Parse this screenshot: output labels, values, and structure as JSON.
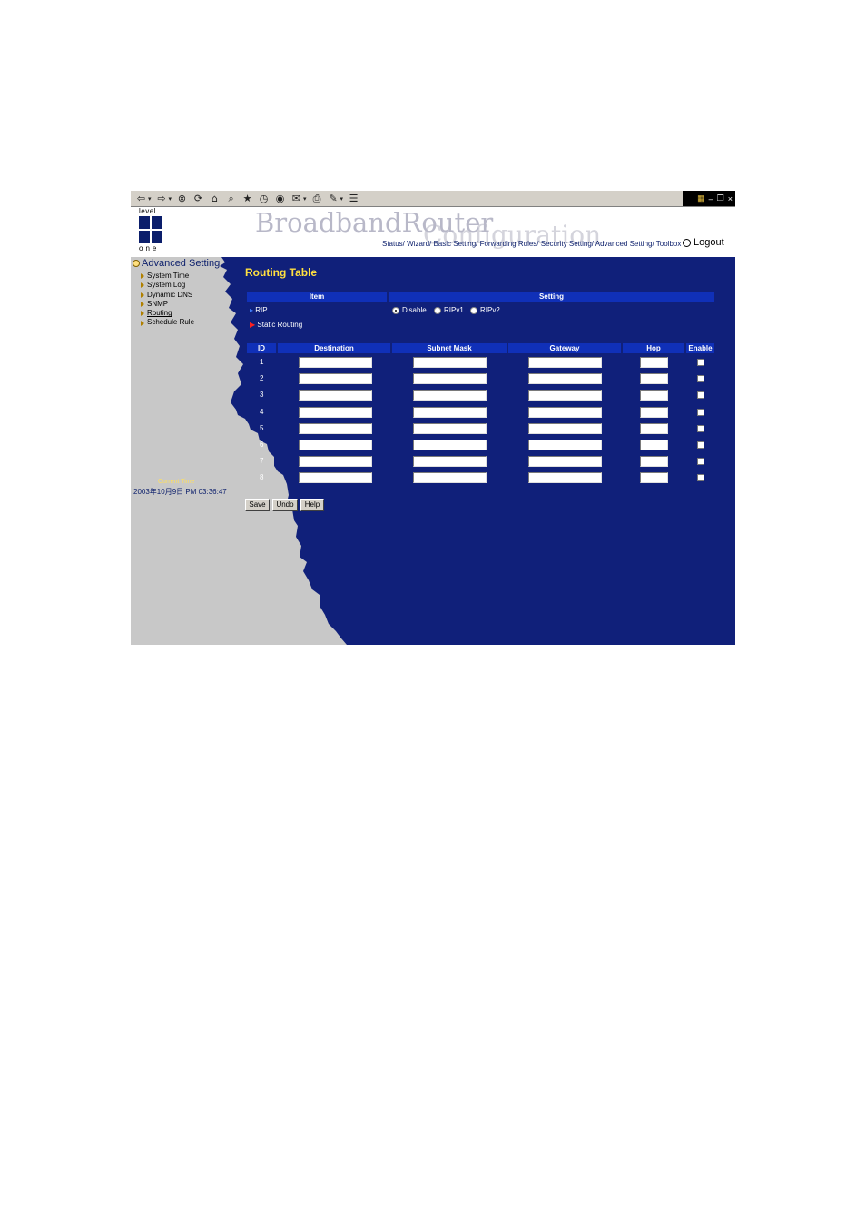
{
  "header": {
    "brand": "BroadbandRouter",
    "brand_sub": "Configuration",
    "logo_top": "level",
    "logo_bottom": "one",
    "nav": "Status/ Wizard/ Basic Setting/ Forwarding Rules/ Security Setting/ Advanced Setting/ Toolbox",
    "logout": "Logout"
  },
  "sidebar": {
    "section": "Advanced Setting",
    "items": [
      {
        "label": "System Time"
      },
      {
        "label": "System Log"
      },
      {
        "label": "Dynamic DNS"
      },
      {
        "label": "SNMP"
      },
      {
        "label": "Routing"
      },
      {
        "label": "Schedule Rule"
      }
    ],
    "current_time_label": "Current Time",
    "current_time_value": "2003年10月9日 PM 03:36:47"
  },
  "main": {
    "title": "Routing Table",
    "item_header": "Item",
    "setting_header": "Setting",
    "rip_label": "RIP",
    "static_routing_label": "Static Routing",
    "rip_options": [
      "Disable",
      "RIPv1",
      "RIPv2"
    ],
    "rip_selected": "Disable",
    "columns": [
      "ID",
      "Destination",
      "Subnet Mask",
      "Gateway",
      "Hop",
      "Enable"
    ],
    "rows": [
      "1",
      "2",
      "3",
      "4",
      "5",
      "6",
      "7",
      "8"
    ],
    "buttons": {
      "save": "Save",
      "undo": "Undo",
      "help": "Help"
    }
  },
  "colors": {
    "background": "#10207a",
    "accent": "#ffe040",
    "header_bar": "#1030b8"
  }
}
